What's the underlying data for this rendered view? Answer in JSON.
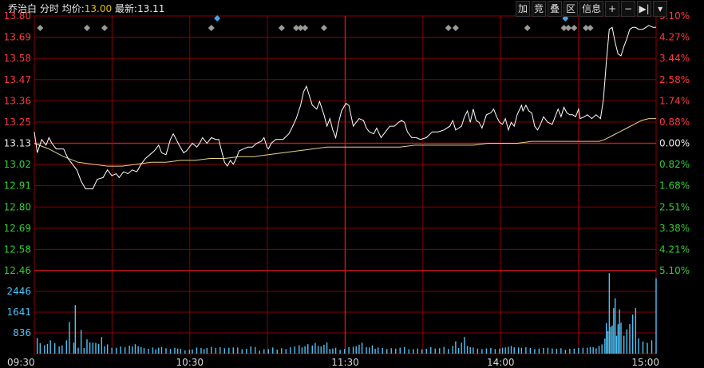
{
  "header": {
    "stock_name": "乔治白",
    "mode": "分时",
    "avg_label": "均价:",
    "avg_value": "13.00",
    "last_label": "最新:",
    "last_value": "13.11"
  },
  "toolbar": {
    "add": "加",
    "overlay1": "竞",
    "overlay2": "叠",
    "zone": "区",
    "info": "信息",
    "plus_icon": "+",
    "minus_icon": "−",
    "jump_icon": "▶|",
    "menu_icon": "▾"
  },
  "colors": {
    "up": "#ff3a3a",
    "down": "#33cc33",
    "price_line": "#ffffff",
    "avg_line": "#e6d48a",
    "grid": "#8b0000",
    "volume_axis": "#4fc3f7"
  },
  "chart_data": {
    "type": "line",
    "x_ticks": [
      "09:30",
      "10:30",
      "11:30",
      "14:00",
      "15:00"
    ],
    "price_ticks": [
      "13.80",
      "13.69",
      "13.58",
      "13.47",
      "13.36",
      "13.25",
      "13.13",
      "13.02",
      "12.91",
      "12.80",
      "12.69",
      "12.58",
      "12.46"
    ],
    "pct_ticks": [
      "5.10%",
      "4.27%",
      "3.44%",
      "2.58%",
      "1.74%",
      "0.88%",
      "0.00%",
      "0.82%",
      "1.68%",
      "2.51%",
      "3.38%",
      "4.21%",
      "5.10%"
    ],
    "volume_ticks": [
      "2446",
      "1641",
      "836"
    ],
    "preclose": 13.13,
    "ylim": [
      12.46,
      13.8
    ],
    "volume_ylim": [
      0,
      3250
    ],
    "price_line": [
      [
        0,
        13.19
      ],
      [
        2,
        13.08
      ],
      [
        5,
        13.15
      ],
      [
        8,
        13.12
      ],
      [
        10,
        13.16
      ],
      [
        12,
        13.13
      ],
      [
        15,
        13.1
      ],
      [
        20,
        13.1
      ],
      [
        23,
        13.05
      ],
      [
        26,
        13.02
      ],
      [
        29,
        12.99
      ],
      [
        32,
        12.93
      ],
      [
        35,
        12.89
      ],
      [
        40,
        12.89
      ],
      [
        43,
        12.94
      ],
      [
        47,
        12.95
      ],
      [
        50,
        12.99
      ],
      [
        53,
        12.96
      ],
      [
        56,
        12.97
      ],
      [
        58,
        12.95
      ],
      [
        61,
        12.98
      ],
      [
        64,
        12.97
      ],
      [
        67,
        12.99
      ],
      [
        70,
        12.98
      ],
      [
        73,
        13.02
      ],
      [
        76,
        13.05
      ],
      [
        79,
        13.07
      ],
      [
        82,
        13.09
      ],
      [
        85,
        13.12
      ],
      [
        87,
        13.08
      ],
      [
        90,
        13.07
      ],
      [
        93,
        13.15
      ],
      [
        95,
        13.18
      ],
      [
        97,
        13.15
      ],
      [
        99,
        13.12
      ],
      [
        102,
        13.08
      ],
      [
        104,
        13.09
      ],
      [
        106,
        13.11
      ],
      [
        108,
        13.13
      ],
      [
        111,
        13.11
      ],
      [
        113,
        13.13
      ],
      [
        115,
        13.16
      ],
      [
        118,
        13.13
      ],
      [
        121,
        13.16
      ],
      [
        124,
        13.15
      ],
      [
        126,
        13.15
      ],
      [
        128,
        13.09
      ],
      [
        130,
        13.03
      ],
      [
        132,
        13.01
      ],
      [
        134,
        13.04
      ],
      [
        136,
        13.02
      ],
      [
        138,
        13.05
      ],
      [
        140,
        13.09
      ],
      [
        143,
        13.1
      ],
      [
        146,
        13.11
      ],
      [
        149,
        13.11
      ],
      [
        152,
        13.13
      ],
      [
        155,
        13.14
      ],
      [
        157,
        13.16
      ],
      [
        159,
        13.11
      ],
      [
        160,
        13.1
      ],
      [
        162,
        13.13
      ],
      [
        165,
        13.15
      ],
      [
        170,
        13.15
      ],
      [
        174,
        13.18
      ],
      [
        176,
        13.21
      ],
      [
        179,
        13.26
      ],
      [
        182,
        13.33
      ],
      [
        184,
        13.4
      ],
      [
        186,
        13.43
      ],
      [
        188,
        13.38
      ],
      [
        190,
        13.33
      ],
      [
        193,
        13.31
      ],
      [
        195,
        13.35
      ],
      [
        198,
        13.28
      ],
      [
        200,
        13.22
      ],
      [
        202,
        13.26
      ],
      [
        204,
        13.2
      ],
      [
        206,
        13.16
      ],
      [
        208,
        13.24
      ],
      [
        210,
        13.3
      ],
      [
        213,
        13.34
      ],
      [
        215,
        13.33
      ],
      [
        218,
        13.22
      ],
      [
        220,
        13.24
      ],
      [
        222,
        13.26
      ],
      [
        225,
        13.25
      ],
      [
        227,
        13.21
      ],
      [
        229,
        13.19
      ],
      [
        232,
        13.18
      ],
      [
        234,
        13.21
      ],
      [
        237,
        13.16
      ],
      [
        240,
        13.19
      ],
      [
        243,
        13.22
      ],
      [
        246,
        13.22
      ],
      [
        249,
        13.24
      ],
      [
        251,
        13.25
      ],
      [
        253,
        13.24
      ],
      [
        255,
        13.19
      ],
      [
        258,
        13.16
      ],
      [
        261,
        13.16
      ],
      [
        264,
        13.15
      ],
      [
        268,
        13.16
      ],
      [
        272,
        13.19
      ],
      [
        276,
        13.19
      ],
      [
        280,
        13.2
      ],
      [
        284,
        13.22
      ],
      [
        286,
        13.25
      ],
      [
        288,
        13.2
      ],
      [
        290,
        13.21
      ],
      [
        292,
        13.22
      ],
      [
        294,
        13.27
      ],
      [
        296,
        13.3
      ],
      [
        298,
        13.24
      ],
      [
        300,
        13.31
      ],
      [
        302,
        13.25
      ],
      [
        304,
        13.24
      ],
      [
        306,
        13.21
      ],
      [
        309,
        13.28
      ],
      [
        312,
        13.29
      ],
      [
        314,
        13.31
      ],
      [
        316,
        13.27
      ],
      [
        318,
        13.24
      ],
      [
        320,
        13.23
      ],
      [
        322,
        13.26
      ],
      [
        324,
        13.2
      ],
      [
        326,
        13.24
      ],
      [
        328,
        13.22
      ],
      [
        330,
        13.28
      ],
      [
        333,
        13.33
      ],
      [
        334,
        13.3
      ],
      [
        336,
        13.33
      ],
      [
        338,
        13.3
      ],
      [
        340,
        13.29
      ],
      [
        342,
        13.22
      ],
      [
        344,
        13.2
      ],
      [
        346,
        13.23
      ],
      [
        348,
        13.27
      ],
      [
        351,
        13.24
      ],
      [
        354,
        13.23
      ],
      [
        356,
        13.27
      ],
      [
        358,
        13.31
      ],
      [
        360,
        13.27
      ],
      [
        362,
        13.32
      ],
      [
        364,
        13.29
      ],
      [
        366,
        13.28
      ],
      [
        368,
        13.28
      ],
      [
        370,
        13.27
      ],
      [
        372,
        13.31
      ],
      [
        373,
        13.26
      ],
      [
        376,
        13.27
      ],
      [
        378,
        13.28
      ],
      [
        381,
        13.26
      ],
      [
        384,
        13.28
      ],
      [
        387,
        13.26
      ],
      [
        389,
        13.36
      ],
      [
        391,
        13.56
      ],
      [
        393,
        13.73
      ],
      [
        395,
        13.74
      ],
      [
        397,
        13.66
      ],
      [
        399,
        13.6
      ],
      [
        401,
        13.59
      ],
      [
        403,
        13.64
      ],
      [
        405,
        13.68
      ],
      [
        407,
        13.73
      ],
      [
        409,
        13.74
      ],
      [
        411,
        13.74
      ],
      [
        413,
        13.73
      ],
      [
        416,
        13.73
      ],
      [
        420,
        13.75
      ],
      [
        423,
        13.74
      ],
      [
        425,
        13.74
      ]
    ],
    "avg_line": [
      [
        0,
        13.13
      ],
      [
        10,
        13.1
      ],
      [
        20,
        13.06
      ],
      [
        30,
        13.03
      ],
      [
        40,
        13.02
      ],
      [
        50,
        13.01
      ],
      [
        60,
        13.01
      ],
      [
        70,
        13.02
      ],
      [
        80,
        13.03
      ],
      [
        90,
        13.03
      ],
      [
        100,
        13.04
      ],
      [
        110,
        13.04
      ],
      [
        120,
        13.05
      ],
      [
        130,
        13.05
      ],
      [
        140,
        13.06
      ],
      [
        150,
        13.06
      ],
      [
        160,
        13.07
      ],
      [
        170,
        13.08
      ],
      [
        180,
        13.09
      ],
      [
        190,
        13.1
      ],
      [
        200,
        13.11
      ],
      [
        210,
        13.11
      ],
      [
        220,
        13.11
      ],
      [
        230,
        13.11
      ],
      [
        240,
        13.11
      ],
      [
        250,
        13.11
      ],
      [
        260,
        13.12
      ],
      [
        270,
        13.12
      ],
      [
        280,
        13.12
      ],
      [
        290,
        13.12
      ],
      [
        300,
        13.12
      ],
      [
        310,
        13.13
      ],
      [
        320,
        13.13
      ],
      [
        330,
        13.13
      ],
      [
        340,
        13.14
      ],
      [
        350,
        13.14
      ],
      [
        360,
        13.14
      ],
      [
        370,
        13.14
      ],
      [
        380,
        13.14
      ],
      [
        386,
        13.14
      ],
      [
        390,
        13.15
      ],
      [
        395,
        13.17
      ],
      [
        400,
        13.19
      ],
      [
        405,
        13.21
      ],
      [
        410,
        13.23
      ],
      [
        415,
        13.25
      ],
      [
        420,
        13.26
      ],
      [
        425,
        13.26
      ]
    ],
    "volume": [
      [
        2,
        610
      ],
      [
        4,
        410
      ],
      [
        7,
        330
      ],
      [
        9,
        380
      ],
      [
        11,
        520
      ],
      [
        14,
        410
      ],
      [
        17,
        280
      ],
      [
        19,
        320
      ],
      [
        22,
        520
      ],
      [
        24,
        1240
      ],
      [
        27,
        430
      ],
      [
        28,
        1900
      ],
      [
        30,
        230
      ],
      [
        32,
        930
      ],
      [
        34,
        220
      ],
      [
        36,
        560
      ],
      [
        38,
        440
      ],
      [
        40,
        430
      ],
      [
        42,
        420
      ],
      [
        44,
        380
      ],
      [
        46,
        650
      ],
      [
        48,
        290
      ],
      [
        50,
        360
      ],
      [
        53,
        230
      ],
      [
        56,
        230
      ],
      [
        59,
        280
      ],
      [
        62,
        250
      ],
      [
        65,
        310
      ],
      [
        67,
        280
      ],
      [
        69,
        370
      ],
      [
        71,
        290
      ],
      [
        73,
        260
      ],
      [
        75,
        220
      ],
      [
        78,
        190
      ],
      [
        81,
        240
      ],
      [
        83,
        170
      ],
      [
        85,
        230
      ],
      [
        87,
        260
      ],
      [
        90,
        210
      ],
      [
        93,
        180
      ],
      [
        96,
        230
      ],
      [
        98,
        200
      ],
      [
        100,
        190
      ],
      [
        103,
        130
      ],
      [
        106,
        150
      ],
      [
        108,
        170
      ],
      [
        111,
        240
      ],
      [
        114,
        220
      ],
      [
        116,
        180
      ],
      [
        118,
        220
      ],
      [
        121,
        270
      ],
      [
        124,
        220
      ],
      [
        127,
        250
      ],
      [
        130,
        210
      ],
      [
        133,
        230
      ],
      [
        136,
        240
      ],
      [
        139,
        240
      ],
      [
        142,
        170
      ],
      [
        145,
        190
      ],
      [
        148,
        280
      ],
      [
        151,
        250
      ],
      [
        154,
        120
      ],
      [
        157,
        170
      ],
      [
        160,
        180
      ],
      [
        163,
        240
      ],
      [
        166,
        160
      ],
      [
        169,
        210
      ],
      [
        172,
        180
      ],
      [
        175,
        250
      ],
      [
        178,
        280
      ],
      [
        181,
        330
      ],
      [
        183,
        240
      ],
      [
        185,
        290
      ],
      [
        187,
        370
      ],
      [
        190,
        320
      ],
      [
        192,
        420
      ],
      [
        194,
        300
      ],
      [
        196,
        280
      ],
      [
        198,
        350
      ],
      [
        200,
        440
      ],
      [
        202,
        180
      ],
      [
        204,
        200
      ],
      [
        206,
        230
      ],
      [
        209,
        150
      ],
      [
        212,
        180
      ],
      [
        215,
        260
      ],
      [
        218,
        270
      ],
      [
        220,
        290
      ],
      [
        222,
        350
      ],
      [
        224,
        430
      ],
      [
        227,
        250
      ],
      [
        229,
        240
      ],
      [
        231,
        320
      ],
      [
        233,
        190
      ],
      [
        235,
        240
      ],
      [
        238,
        220
      ],
      [
        241,
        180
      ],
      [
        244,
        210
      ],
      [
        247,
        200
      ],
      [
        250,
        230
      ],
      [
        253,
        260
      ],
      [
        256,
        170
      ],
      [
        259,
        180
      ],
      [
        262,
        200
      ],
      [
        265,
        170
      ],
      [
        268,
        190
      ],
      [
        271,
        250
      ],
      [
        274,
        200
      ],
      [
        277,
        210
      ],
      [
        280,
        260
      ],
      [
        283,
        180
      ],
      [
        286,
        300
      ],
      [
        288,
        480
      ],
      [
        290,
        220
      ],
      [
        292,
        430
      ],
      [
        294,
        650
      ],
      [
        296,
        300
      ],
      [
        298,
        250
      ],
      [
        300,
        240
      ],
      [
        303,
        200
      ],
      [
        306,
        180
      ],
      [
        309,
        200
      ],
      [
        312,
        220
      ],
      [
        315,
        180
      ],
      [
        318,
        200
      ],
      [
        320,
        230
      ],
      [
        322,
        240
      ],
      [
        324,
        270
      ],
      [
        326,
        300
      ],
      [
        328,
        250
      ],
      [
        331,
        240
      ],
      [
        333,
        230
      ],
      [
        336,
        250
      ],
      [
        339,
        220
      ],
      [
        342,
        180
      ],
      [
        345,
        200
      ],
      [
        348,
        220
      ],
      [
        351,
        230
      ],
      [
        354,
        200
      ],
      [
        357,
        190
      ],
      [
        360,
        210
      ],
      [
        363,
        150
      ],
      [
        366,
        190
      ],
      [
        369,
        200
      ],
      [
        372,
        220
      ],
      [
        375,
        230
      ],
      [
        378,
        230
      ],
      [
        380,
        260
      ],
      [
        382,
        250
      ],
      [
        384,
        210
      ],
      [
        386,
        300
      ],
      [
        388,
        360
      ],
      [
        390,
        590
      ],
      [
        391,
        1200
      ],
      [
        392,
        880
      ],
      [
        393,
        3150
      ],
      [
        394,
        1050
      ],
      [
        395,
        1100
      ],
      [
        396,
        1780
      ],
      [
        397,
        2170
      ],
      [
        398,
        700
      ],
      [
        399,
        1150
      ],
      [
        400,
        1730
      ],
      [
        401,
        1210
      ],
      [
        403,
        700
      ],
      [
        405,
        950
      ],
      [
        407,
        1160
      ],
      [
        409,
        1530
      ],
      [
        411,
        1780
      ],
      [
        413,
        600
      ],
      [
        416,
        480
      ],
      [
        419,
        420
      ],
      [
        422,
        520
      ],
      [
        425,
        2950
      ]
    ],
    "markers": [
      {
        "t": 4,
        "color": "grey"
      },
      {
        "t": 36,
        "color": "grey"
      },
      {
        "t": 48,
        "color": "grey"
      },
      {
        "t": 121,
        "color": "grey"
      },
      {
        "t": 125,
        "color": "blue",
        "row": "top"
      },
      {
        "t": 169,
        "color": "grey"
      },
      {
        "t": 179,
        "color": "grey"
      },
      {
        "t": 182,
        "color": "grey"
      },
      {
        "t": 185,
        "color": "grey"
      },
      {
        "t": 198,
        "color": "grey"
      },
      {
        "t": 283,
        "color": "grey"
      },
      {
        "t": 288,
        "color": "grey"
      },
      {
        "t": 337,
        "color": "grey"
      },
      {
        "t": 363,
        "color": "blue",
        "row": "top"
      },
      {
        "t": 362,
        "color": "grey"
      },
      {
        "t": 365,
        "color": "grey"
      },
      {
        "t": 369,
        "color": "grey"
      },
      {
        "t": 377,
        "color": "grey"
      },
      {
        "t": 380,
        "color": "grey"
      }
    ]
  }
}
